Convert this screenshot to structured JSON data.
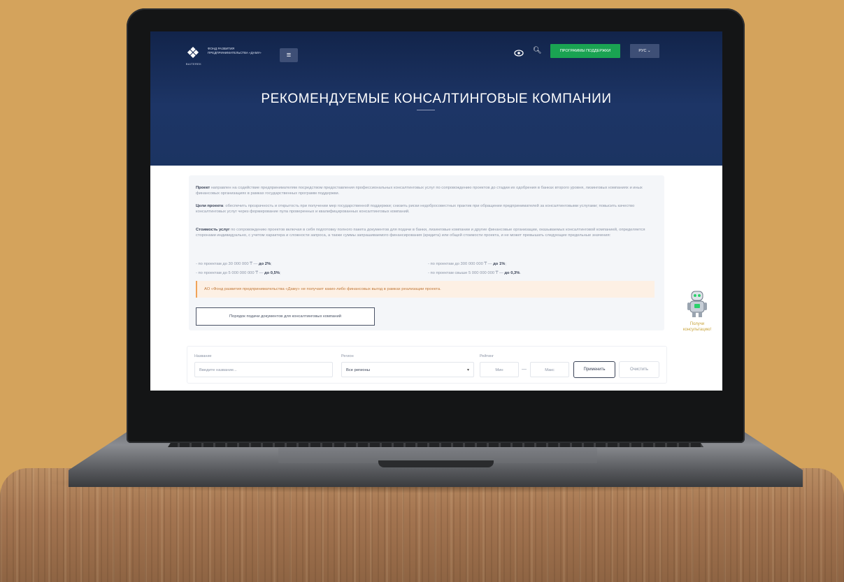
{
  "header": {
    "logo_subtitle": "BAITEREK",
    "logo_text": "ФОНД РАЗВИТИЯ ПРЕДПРИНИМАТЕЛЬСТВА «ДАМУ»",
    "menu_icon": "menu-icon",
    "accessibility_icon": "eye-icon",
    "search_icon": "search-icon",
    "programs_label": "ПРОГРАММЫ ПОДДЕРЖКИ",
    "lang_label": "РУС",
    "colors": {
      "hero": "#1d3566",
      "programs": "#1aa352"
    }
  },
  "page_title": "РЕКОМЕНДУЕМЫЕ КОНСАЛТИНГОВЫЕ КОМПАНИИ",
  "info": {
    "p1_bold": "Проект",
    "p1_text": "направлен на содействие предпринимателям посредством предоставления профессиональных консалтинговых услуг по сопровождению проектов до стадии их одобрения в банках второго уровня, лизинговых компаниях и иных финансовых организациях в рамках государственных программ поддержки.",
    "p2_bold": "Цели проекта",
    "p2_text": ": обеспечить прозрачность и открытость при получении мер государственной поддержки; снизить риски недобросовестных практик при обращении предпринимателей за консалтинговыми услугами; повысить качество консалтинговых услуг через формирование пула проверенных и квалифицированных консалтинговых компаний.",
    "p3_bold": "Стоимость услуг",
    "p3_text": "по сопровождению проектов включая в себя подготовку полного пакета документов для подачи в банки, лизинговые компании и другие финансовые организации, оказываемых консалтинговой компанией, определяется сторонами индивидуально, с учетом характера и сложности запроса, а также суммы запрашиваемого финансирования (кредита) или общей стоимости проекта, и не может превышать следующие предельные значения:",
    "tiers": [
      {
        "text": "по проектам до 30 000 000 ₸ — ",
        "rate": "до 2%"
      },
      {
        "text": "по проектам до 300 000 000 ₸ — ",
        "rate": "до 1%"
      },
      {
        "text": "по проектам до 5 000 000 000 ₸ — ",
        "rate": "до 0,5%"
      },
      {
        "text": "по проектам свыше 5 000 000 000 ₸ — ",
        "rate": "до 0,3%"
      }
    ],
    "notice": "АО «Фонд развития предпринимательства «Даму» не получает каких-либо финансовых выгод в рамках реализации проекта.",
    "docs_button": "Порядок подачи документов для консалтинговых компаний"
  },
  "bot": {
    "label_line1": "Получи",
    "label_line2": "консультацию!"
  },
  "filter": {
    "name_label": "Название",
    "name_placeholder": "Введите название...",
    "region_label": "Регион",
    "region_value": "Все регионы",
    "rating_label": "Рейтинг",
    "rating_min": "Мин",
    "rating_max": "Макс",
    "apply": "Применить",
    "clear": "Очистить"
  }
}
